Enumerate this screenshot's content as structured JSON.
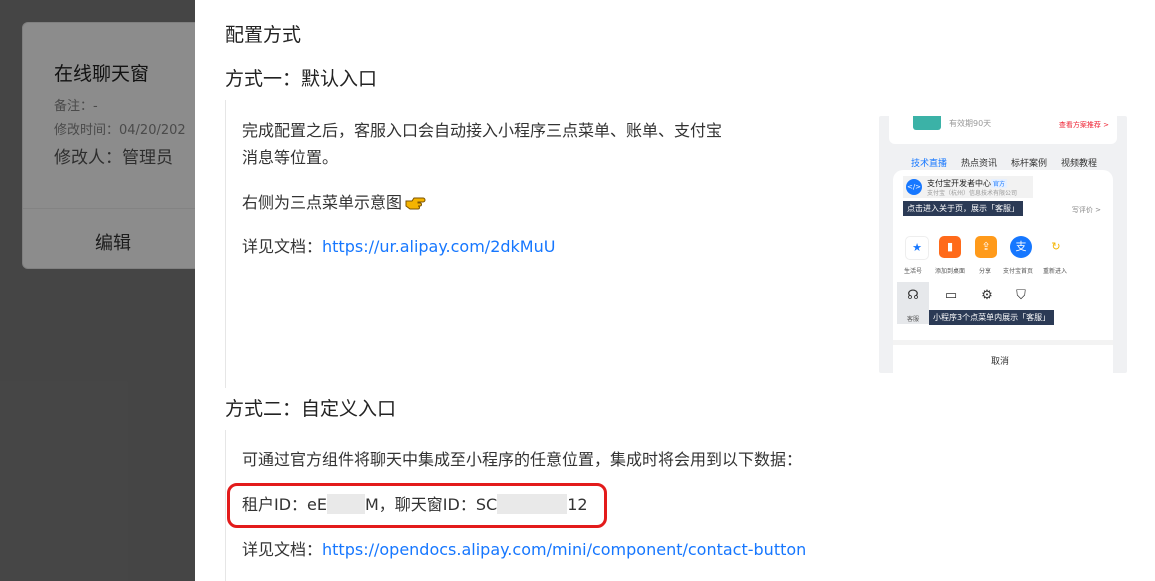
{
  "background_card": {
    "title": "在线聊天窗",
    "remark": "备注：-",
    "modified_time": "修改时间：04/20/202",
    "modifier": "修改人：管理员",
    "edit_label": "编辑"
  },
  "drawer": {
    "config_heading": "配置方式",
    "method_one": {
      "heading": "方式一：默认入口",
      "desc_line1": "完成配置之后，客服入口会自动接入小程序三点菜单、账单、支付宝",
      "desc_line2": "消息等位置。",
      "pointer_text": "右侧为三点菜单示意图",
      "doc_prefix": "详见文档：",
      "doc_link": "https://ur.alipay.com/2dkMuU"
    },
    "method_two": {
      "heading": "方式二：自定义入口",
      "desc": "可通过官方组件将聊天中集成至小程序的任意位置，集成时将会用到以下数据：",
      "tenant_prefix": "租户ID：eE",
      "tenant_suffix": "M，聊天窗ID：SC",
      "chat_suffix": "12",
      "doc_prefix": "详见文档：",
      "doc_link": "https://opendocs.alipay.com/mini/component/contact-button"
    }
  },
  "phone_mock": {
    "top_text": "有效期90天",
    "top_link": "查看方案推荐 >",
    "tabs": [
      "技术直播",
      "热点资讯",
      "标杆案例",
      "视频教程"
    ],
    "dev_name": "支付宝开发者中心",
    "dev_badge": "官方",
    "dev_sub": "支付宝（杭州）信息技术有限公司",
    "tip_about": "点击进入关于页，展示「客服」",
    "feedback": "写评价 >",
    "row1": [
      "生活号",
      "添加到桌面",
      "分享",
      "支付宝首页",
      "重新进入"
    ],
    "row2_first": "客服",
    "tip_menu": "小程序3个点菜单内展示「客服」",
    "cancel": "取消",
    "accent": "#1677ff"
  }
}
